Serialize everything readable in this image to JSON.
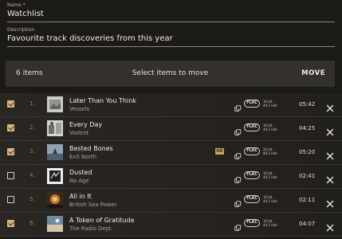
{
  "form": {
    "name_label": "Name *",
    "name_value": "Watchlist",
    "description_label": "Description",
    "description_value": "Favourite track discoveries from this year"
  },
  "toolbar": {
    "count": "6 items",
    "hint": "Select items to move",
    "move_label": "MOVE"
  },
  "tracks": [
    {
      "num": "1.",
      "title": "Later Than You Think",
      "artist": "Vessels",
      "checked": true,
      "hd": false,
      "format": "FLAC",
      "quality": [
        "16 bit",
        "44.1 kHz"
      ],
      "duration": "05:42"
    },
    {
      "num": "2.",
      "title": "Every Day",
      "artist": "Voxtrot",
      "checked": true,
      "hd": false,
      "format": "FLAC",
      "quality": [
        "16 bit",
        "44.1 kHz"
      ],
      "duration": "04:25"
    },
    {
      "num": "3.",
      "title": "Bested Bones",
      "artist": "Exit North",
      "checked": true,
      "hd": true,
      "hd_label": "HD",
      "format": "FLAC",
      "quality": [
        "24 bit",
        "88.2 kHz"
      ],
      "duration": "05:20"
    },
    {
      "num": "4.",
      "title": "Dusted",
      "artist": "No Age",
      "checked": false,
      "hd": false,
      "format": "FLAC",
      "quality": [
        "16 bit",
        "44.1 kHz"
      ],
      "duration": "02:41"
    },
    {
      "num": "5.",
      "title": "All in It",
      "artist": "British Sea Power",
      "checked": false,
      "hd": false,
      "format": "FLAC",
      "quality": [
        "16 bit",
        "44.1 kHz"
      ],
      "duration": "02:11"
    },
    {
      "num": "6.",
      "title": "A Token of Gratitude",
      "artist": "The Radio Dept.",
      "checked": true,
      "hd": false,
      "format": "FLAC",
      "quality": [
        "16 bit",
        "44.1 kHz"
      ],
      "duration": "04:07"
    }
  ],
  "colors": {
    "accent": "#d8b67a",
    "background": "#1c1a17",
    "toolbar": "#34312c"
  },
  "icons": {
    "checkbox": "checkbox-icon",
    "copy": "copy-icon",
    "close": "close-icon"
  }
}
